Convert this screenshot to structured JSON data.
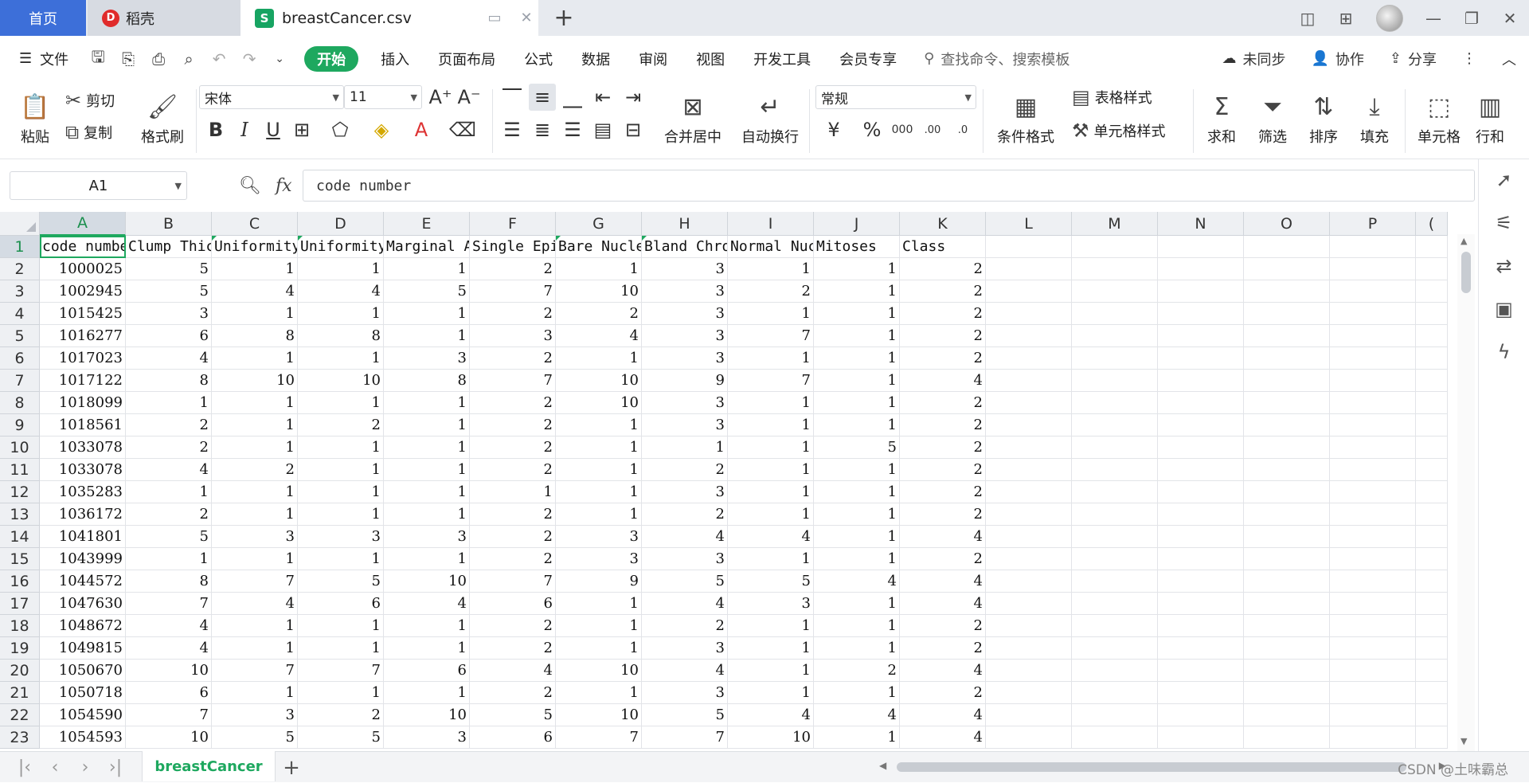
{
  "tabs": {
    "home": "首页",
    "docer": "稻壳",
    "file": "breastCancer.csv"
  },
  "menu": {
    "file": "文件",
    "items": [
      "开始",
      "插入",
      "页面布局",
      "公式",
      "数据",
      "审阅",
      "视图",
      "开发工具",
      "会员专享"
    ],
    "search_placeholder": "查找命令、搜索模板",
    "sync": "未同步",
    "collab": "协作",
    "share": "分享"
  },
  "ribbon": {
    "paste": "粘贴",
    "cut": "剪切",
    "copy": "复制",
    "format_painter": "格式刷",
    "font_name": "宋体",
    "font_size": "11",
    "merge_center": "合并居中",
    "wrap_text": "自动换行",
    "number_format": "常规",
    "conditional_format": "条件格式",
    "table_style": "表格样式",
    "cell_style": "单元格样式",
    "sum": "求和",
    "filter": "筛选",
    "sort": "排序",
    "fill": "填充",
    "cell": "单元格",
    "row_col": "行和"
  },
  "formula_bar": {
    "name_box": "A1",
    "formula": "code number"
  },
  "sheet": {
    "columns": [
      "A",
      "B",
      "C",
      "D",
      "E",
      "F",
      "G",
      "H",
      "I",
      "J",
      "K",
      "L",
      "M",
      "N",
      "O",
      "P",
      "("
    ],
    "row_numbers": [
      "1",
      "2",
      "3",
      "4",
      "5",
      "6",
      "7",
      "8",
      "9",
      "10",
      "11",
      "12",
      "13",
      "14",
      "15",
      "16",
      "17",
      "18",
      "19",
      "20",
      "21",
      "22",
      "23"
    ],
    "headers": [
      "code number",
      "Clump Thickness",
      "Uniformity of Cell Size",
      "Uniformity of Cell Shape",
      "Marginal Adhesion",
      "Single Epithelial Cell Size",
      "Bare Nuclei",
      "Bland Chromatin",
      "Normal Nucleoli",
      "Mitoses",
      "Class"
    ],
    "rows": [
      [
        "1000025",
        "5",
        "1",
        "1",
        "1",
        "2",
        "1",
        "3",
        "1",
        "1",
        "2"
      ],
      [
        "1002945",
        "5",
        "4",
        "4",
        "5",
        "7",
        "10",
        "3",
        "2",
        "1",
        "2"
      ],
      [
        "1015425",
        "3",
        "1",
        "1",
        "1",
        "2",
        "2",
        "3",
        "1",
        "1",
        "2"
      ],
      [
        "1016277",
        "6",
        "8",
        "8",
        "1",
        "3",
        "4",
        "3",
        "7",
        "1",
        "2"
      ],
      [
        "1017023",
        "4",
        "1",
        "1",
        "3",
        "2",
        "1",
        "3",
        "1",
        "1",
        "2"
      ],
      [
        "1017122",
        "8",
        "10",
        "10",
        "8",
        "7",
        "10",
        "9",
        "7",
        "1",
        "4"
      ],
      [
        "1018099",
        "1",
        "1",
        "1",
        "1",
        "2",
        "10",
        "3",
        "1",
        "1",
        "2"
      ],
      [
        "1018561",
        "2",
        "1",
        "2",
        "1",
        "2",
        "1",
        "3",
        "1",
        "1",
        "2"
      ],
      [
        "1033078",
        "2",
        "1",
        "1",
        "1",
        "2",
        "1",
        "1",
        "1",
        "5",
        "2"
      ],
      [
        "1033078",
        "4",
        "2",
        "1",
        "1",
        "2",
        "1",
        "2",
        "1",
        "1",
        "2"
      ],
      [
        "1035283",
        "1",
        "1",
        "1",
        "1",
        "1",
        "1",
        "3",
        "1",
        "1",
        "2"
      ],
      [
        "1036172",
        "2",
        "1",
        "1",
        "1",
        "2",
        "1",
        "2",
        "1",
        "1",
        "2"
      ],
      [
        "1041801",
        "5",
        "3",
        "3",
        "3",
        "2",
        "3",
        "4",
        "4",
        "1",
        "4"
      ],
      [
        "1043999",
        "1",
        "1",
        "1",
        "1",
        "2",
        "3",
        "3",
        "1",
        "1",
        "2"
      ],
      [
        "1044572",
        "8",
        "7",
        "5",
        "10",
        "7",
        "9",
        "5",
        "5",
        "4",
        "4"
      ],
      [
        "1047630",
        "7",
        "4",
        "6",
        "4",
        "6",
        "1",
        "4",
        "3",
        "1",
        "4"
      ],
      [
        "1048672",
        "4",
        "1",
        "1",
        "1",
        "2",
        "1",
        "2",
        "1",
        "1",
        "2"
      ],
      [
        "1049815",
        "4",
        "1",
        "1",
        "1",
        "2",
        "1",
        "3",
        "1",
        "1",
        "2"
      ],
      [
        "1050670",
        "10",
        "7",
        "7",
        "6",
        "4",
        "10",
        "4",
        "1",
        "2",
        "4"
      ],
      [
        "1050718",
        "6",
        "1",
        "1",
        "1",
        "2",
        "1",
        "3",
        "1",
        "1",
        "2"
      ],
      [
        "1054590",
        "7",
        "3",
        "2",
        "10",
        "5",
        "10",
        "5",
        "4",
        "4",
        "4"
      ],
      [
        "1054593",
        "10",
        "5",
        "5",
        "3",
        "6",
        "7",
        "7",
        "10",
        "1",
        "4"
      ]
    ],
    "sheet_tab": "breastCancer"
  },
  "watermark": "CSDN @土味霸总",
  "colors": {
    "accent": "#1ea85f",
    "home_tab": "#3d6fd9"
  }
}
